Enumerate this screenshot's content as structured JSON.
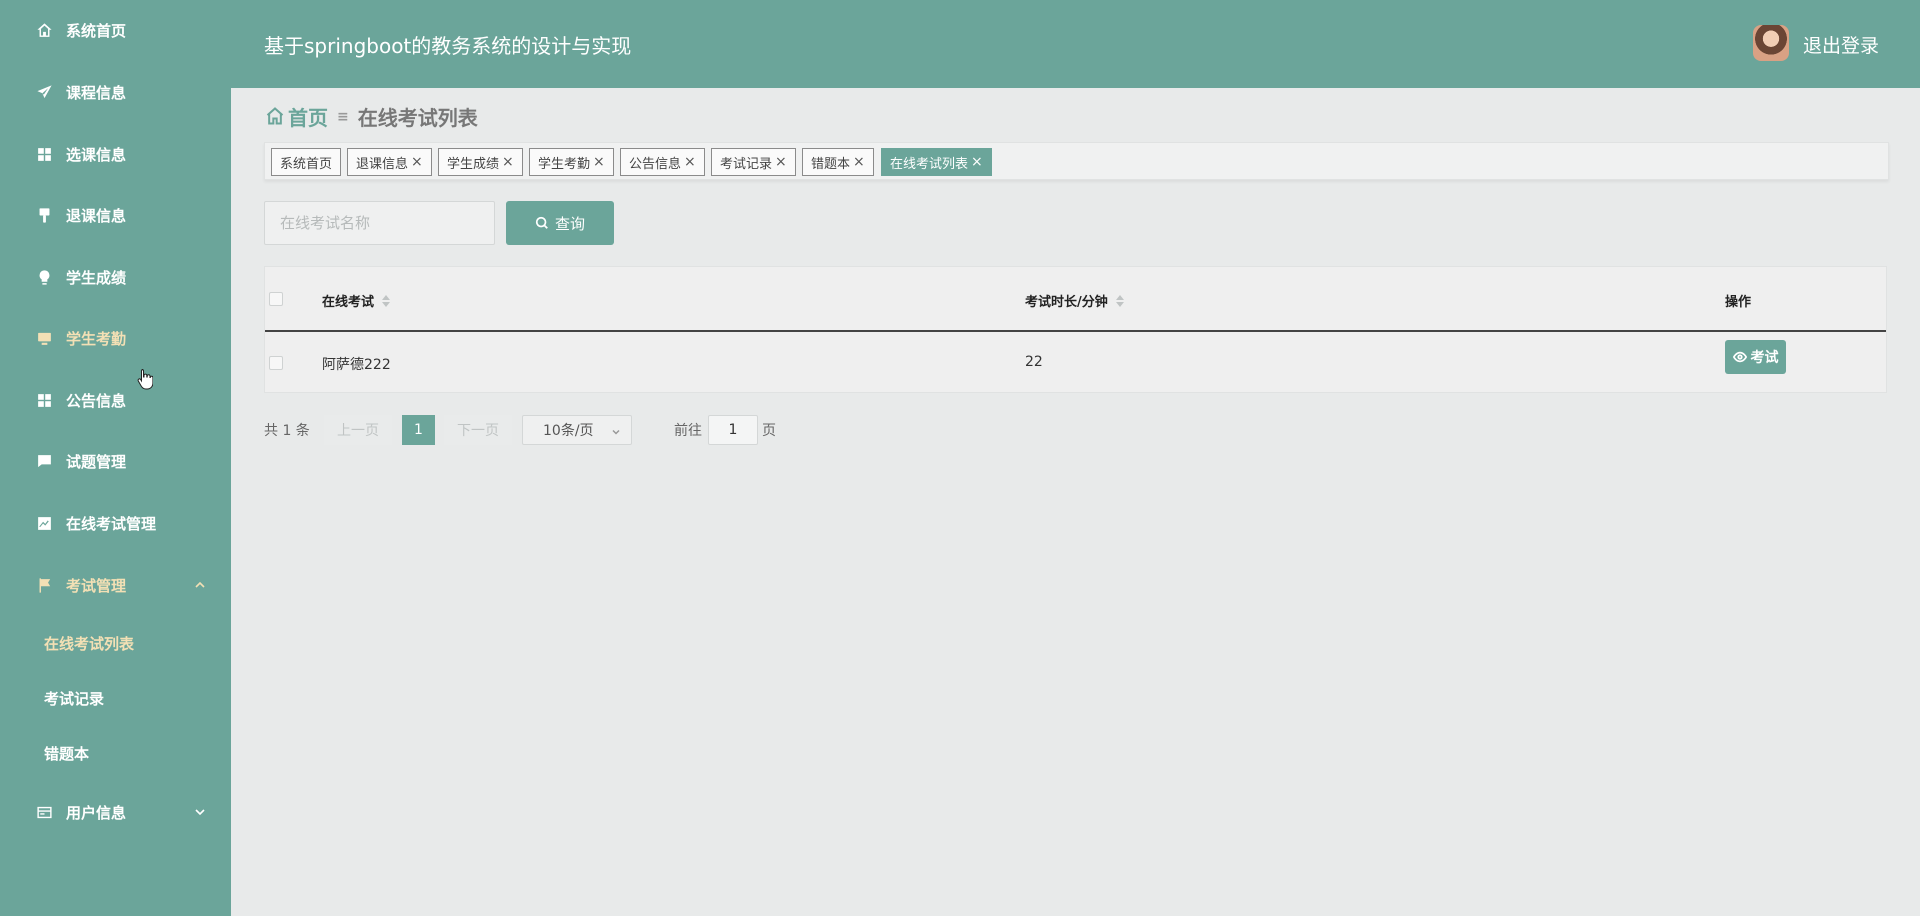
{
  "sidebar": {
    "items": [
      {
        "label": "系统首页",
        "icon": "home-icon"
      },
      {
        "label": "课程信息",
        "icon": "send-icon"
      },
      {
        "label": "选课信息",
        "icon": "grid-icon"
      },
      {
        "label": "退课信息",
        "icon": "brush-icon"
      },
      {
        "label": "学生成绩",
        "icon": "bulb-icon"
      },
      {
        "label": "学生考勤",
        "icon": "monitor-icon"
      },
      {
        "label": "公告信息",
        "icon": "grid-icon"
      },
      {
        "label": "试题管理",
        "icon": "chat-icon"
      },
      {
        "label": "在线考试管理",
        "icon": "chart-icon"
      },
      {
        "label": "考试管理",
        "icon": "flag-icon"
      },
      {
        "label": "用户信息",
        "icon": "card-icon"
      }
    ],
    "sub_items": [
      "在线考试列表",
      "考试记录",
      "错题本"
    ]
  },
  "header": {
    "title": "基于springboot的教务系统的设计与实现",
    "logout": "退出登录"
  },
  "breadcrumb": {
    "home": "首页",
    "current": "在线考试列表"
  },
  "tags": [
    {
      "label": "系统首页",
      "closable": false
    },
    {
      "label": "退课信息",
      "closable": true
    },
    {
      "label": "学生成绩",
      "closable": true
    },
    {
      "label": "学生考勤",
      "closable": true
    },
    {
      "label": "公告信息",
      "closable": true
    },
    {
      "label": "考试记录",
      "closable": true
    },
    {
      "label": "错题本",
      "closable": true
    },
    {
      "label": "在线考试列表",
      "closable": true,
      "active": true
    }
  ],
  "search": {
    "placeholder": "在线考试名称",
    "button": "查询"
  },
  "table": {
    "columns": [
      "在线考试",
      "考试时长/分钟",
      "操作"
    ],
    "rows": [
      {
        "name": "阿萨德222",
        "duration": "22",
        "action": "考试"
      }
    ]
  },
  "pagination": {
    "total": "共 1 条",
    "prev": "上一页",
    "page": "1",
    "next": "下一页",
    "page_size": "10条/页",
    "goto": "前往",
    "jump_value": "1",
    "page_suffix": "页"
  },
  "colors": {
    "primary": "#6ba59a",
    "active_text": "#f3e0b5"
  }
}
